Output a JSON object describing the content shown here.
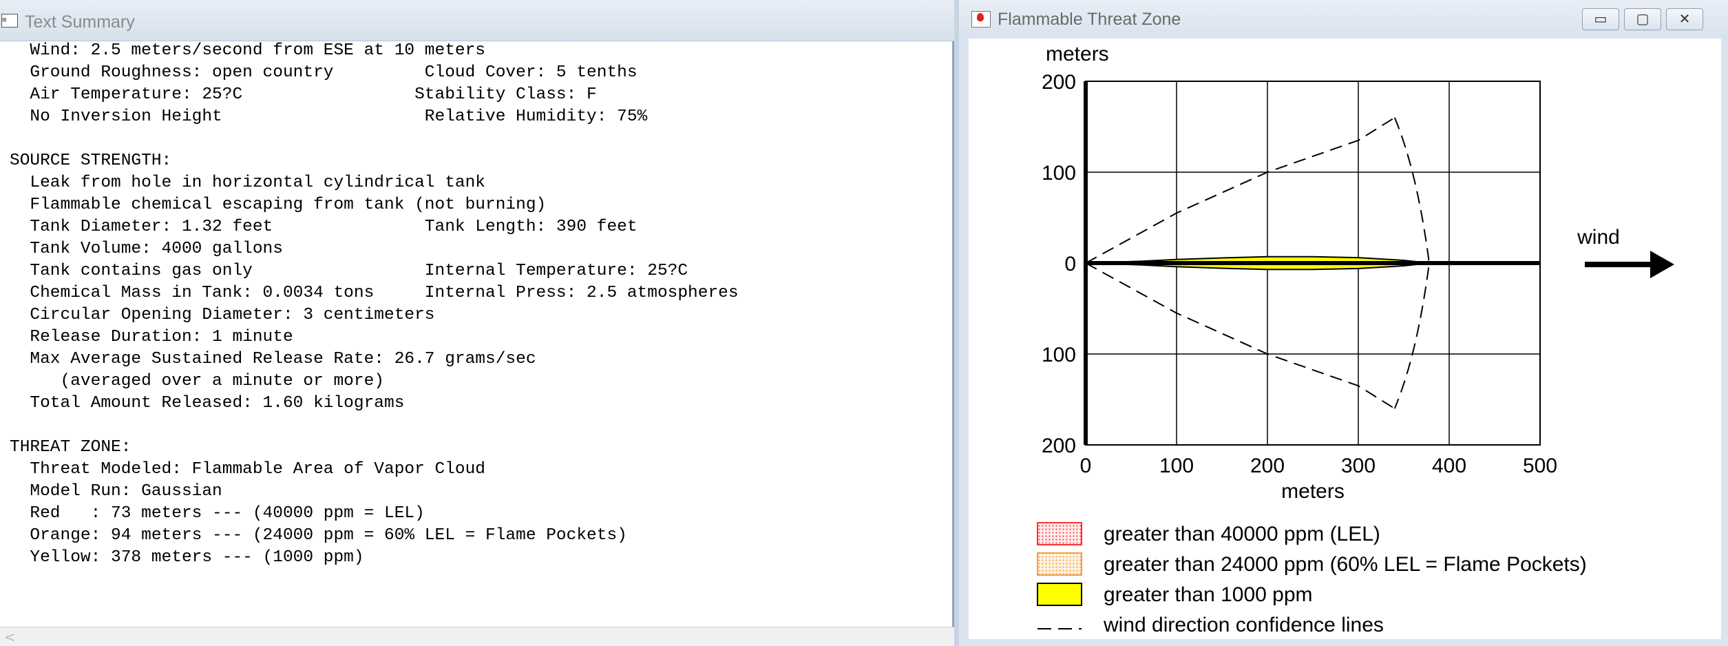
{
  "left_window": {
    "title": "Text Summary",
    "icon": "text-doc-icon",
    "lines": [
      "  Wind: 2.5 meters/second from ESE at 10 meters",
      "  Ground Roughness: open country         Cloud Cover: 5 tenths",
      "  Air Temperature: 25?C                 Stability Class: F",
      "  No Inversion Height                    Relative Humidity: 75%",
      "",
      "SOURCE STRENGTH:",
      "  Leak from hole in horizontal cylindrical tank",
      "  Flammable chemical escaping from tank (not burning)",
      "  Tank Diameter: 1.32 feet               Tank Length: 390 feet",
      "  Tank Volume: 4000 gallons",
      "  Tank contains gas only                 Internal Temperature: 25?C",
      "  Chemical Mass in Tank: 0.0034 tons     Internal Press: 2.5 atmospheres",
      "  Circular Opening Diameter: 3 centimeters",
      "  Release Duration: 1 minute",
      "  Max Average Sustained Release Rate: 26.7 grams/sec",
      "     (averaged over a minute or more)",
      "  Total Amount Released: 1.60 kilograms",
      "",
      "THREAT ZONE:",
      "  Threat Modeled: Flammable Area of Vapor Cloud",
      "  Model Run: Gaussian",
      "  Red   : 73 meters --- (40000 ppm = LEL)",
      "  Orange: 94 meters --- (24000 ppm = 60% LEL = Flame Pockets)",
      "  Yellow: 378 meters --- (1000 ppm)"
    ],
    "scroll_left_glyph": "<"
  },
  "right_window": {
    "title": "Flammable Threat Zone",
    "icon": "threat-zone-app-icon",
    "buttons": {
      "minimize": "▭",
      "maximize": "▢",
      "close": "✕"
    }
  },
  "chart_data": {
    "type": "area",
    "ylabel": "meters",
    "xlabel": "meters",
    "xlim": [
      0,
      500
    ],
    "ylim": [
      -200,
      200
    ],
    "x_ticks": [
      "0",
      "100",
      "200",
      "300",
      "400",
      "500"
    ],
    "y_ticks": [
      "200",
      "100",
      "0",
      "100",
      "200"
    ],
    "grid": true,
    "wind_label": "wind",
    "zones": [
      {
        "name": "Red",
        "threshold_ppm": 40000,
        "distance_m": 73,
        "color": "#ff5a5a"
      },
      {
        "name": "Orange",
        "threshold_ppm": 24000,
        "distance_m": 94,
        "color": "#f5b15a"
      },
      {
        "name": "Yellow",
        "threshold_ppm": 1000,
        "distance_m": 378,
        "color": "#ffff00"
      }
    ],
    "yellow_halfwidth": [
      [
        0,
        0
      ],
      [
        60,
        2
      ],
      [
        100,
        4
      ],
      [
        160,
        6
      ],
      [
        200,
        7
      ],
      [
        250,
        7
      ],
      [
        300,
        6
      ],
      [
        350,
        3
      ],
      [
        378,
        0
      ]
    ],
    "confidence_lines": {
      "upper": [
        [
          0,
          0
        ],
        [
          100,
          55
        ],
        [
          200,
          100
        ],
        [
          300,
          135
        ],
        [
          340,
          160
        ]
      ],
      "lower": [
        [
          0,
          0
        ],
        [
          100,
          -55
        ],
        [
          200,
          -100
        ],
        [
          300,
          -135
        ],
        [
          340,
          -160
        ]
      ],
      "arc": [
        [
          340,
          160
        ],
        [
          365,
          100
        ],
        [
          378,
          0
        ],
        [
          365,
          -100
        ],
        [
          340,
          -160
        ]
      ]
    },
    "legend": [
      {
        "label": "greater than 40000 ppm (LEL)",
        "swatch": "red-dotted",
        "color": "#ff6060"
      },
      {
        "label": "greater than 24000 ppm (60% LEL = Flame Pockets)",
        "swatch": "orange-dotted",
        "color": "#f4a84a"
      },
      {
        "label": "greater than 1000 ppm",
        "swatch": "yellow-solid",
        "color": "#ffff00"
      },
      {
        "label": "wind direction confidence lines",
        "swatch": "dashed-line",
        "color": "#000000"
      }
    ]
  }
}
